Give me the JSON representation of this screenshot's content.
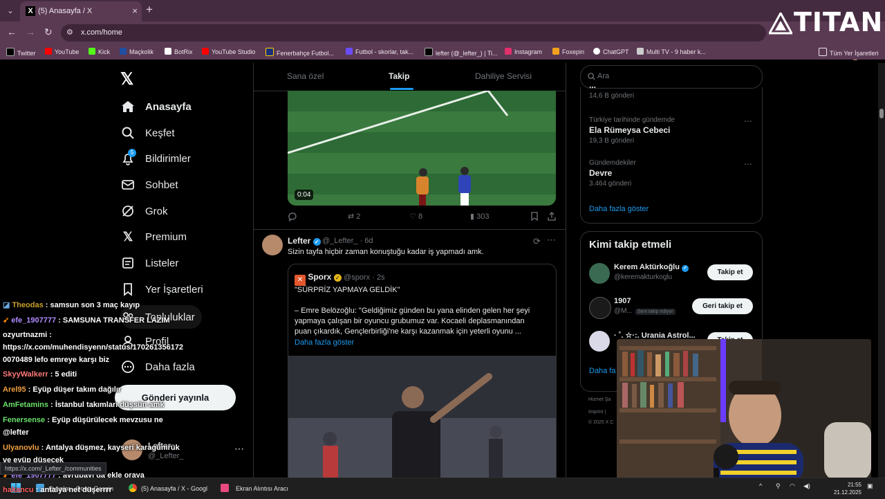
{
  "browser": {
    "tab_title": "(5) Anasayfa / X",
    "tab_close": "×",
    "new_tab": "+",
    "url": "x.com/home",
    "overlay_brand": "TITAN",
    "bookmarks": [
      {
        "label": "Twitter",
        "color": "#000000"
      },
      {
        "label": "YouTube",
        "color": "#ff0000"
      },
      {
        "label": "Kick",
        "color": "#53fc18"
      },
      {
        "label": "Maçkolik",
        "color": "#1f4ea3"
      },
      {
        "label": "BotRix",
        "color": "#ffffff"
      },
      {
        "label": "YouTube Studio",
        "color": "#ff0000"
      },
      {
        "label": "Fenerbahçe Futbol...",
        "color": "#1b2f7a"
      },
      {
        "label": "Futbol - skorlar, tak...",
        "color": "#6a4cff"
      },
      {
        "label": "lefter (@_lefter_) | Ti...",
        "color": "#000000"
      },
      {
        "label": "Instagram",
        "color": "#e1306c"
      },
      {
        "label": "Foxepin",
        "color": "#f4a21d"
      },
      {
        "label": "ChatGPT",
        "color": "#ffffff"
      },
      {
        "label": "Multi TV - 9 haber k...",
        "color": "#cccccc"
      }
    ],
    "all_bookmarks": "Tüm Yer İşaretleri"
  },
  "sidebar": {
    "items": [
      {
        "label": "Anasayfa",
        "icon": "home-icon"
      },
      {
        "label": "Keşfet",
        "icon": "search-icon"
      },
      {
        "label": "Bildirimler",
        "icon": "bell-icon"
      },
      {
        "label": "Sohbet",
        "icon": "mail-icon"
      },
      {
        "label": "Grok",
        "icon": "grok-icon"
      },
      {
        "label": "Premium",
        "icon": "x-premium-icon"
      },
      {
        "label": "Listeler",
        "icon": "list-icon"
      },
      {
        "label": "Yer İşaretleri",
        "icon": "bookmark-icon"
      },
      {
        "label": "Topluluklar",
        "icon": "communities-icon"
      },
      {
        "label": "Profil",
        "icon": "profile-icon"
      },
      {
        "label": "Daha fazla",
        "icon": "more-icon"
      }
    ],
    "notification_count": "5",
    "post_button": "Gönderi yayınla",
    "account_name": "Lefter",
    "account_handle": "@_Lefter_"
  },
  "feed": {
    "tabs": [
      "Sana özel",
      "Takip",
      "Dahiliye Servisi"
    ],
    "video_time": "0:04",
    "post1_stats": {
      "reposts": "2",
      "likes": "8",
      "views": "303"
    },
    "post2": {
      "name": "Lefter",
      "handle": "@_Lefter_ · 6d",
      "text": "Sizin tayfa hiçbir zaman konuştuğu kadar iş yapmadı amk.",
      "quote": {
        "name": "Sporx",
        "handle": "@sporx · 2s",
        "lines": [
          "\"SÜRPRİZ YAPMAYA GELDİK\"",
          "– Emre Belözoğlu: \"Geldiğimiz günden bu yana elinden gelen her şeyi",
          "yapmaya çalışan bir oyuncu grubumuz var. Kocaeli deplasmanından",
          "puan çıkardık, Gençlerbirliği'ne karşı kazanmak için yeterli oyunu ..."
        ],
        "more": "Daha fazla göster"
      }
    }
  },
  "right": {
    "search_placeholder": "Ara",
    "trends": [
      {
        "category": "",
        "name": "...",
        "count": "14,6 B gönderi"
      },
      {
        "category": "Türkiye tarihinde gündemde",
        "name": "Ela Rümeysa Cebeci",
        "count": "19,3 B gönderi"
      },
      {
        "category": "Gündemdekiler",
        "name": "Devre",
        "count": "3.464 gönderi"
      }
    ],
    "trends_more": "Daha fazla göster",
    "who_title": "Kimi takip etmeli",
    "who": [
      {
        "name": "Kerem Aktürkoğlu",
        "handle": "@keremakturkoglu",
        "button": "Takip et",
        "badge": ""
      },
      {
        "name": "1907",
        "handle": "@M...",
        "button": "Geri takip et",
        "badge": "Seni takip ediyor"
      },
      {
        "name": "· ˚. ☆·:. Urania Astrol...",
        "handle": "",
        "button": "Takip et",
        "badge": ""
      }
    ],
    "who_more": "Daha fa",
    "footer_lines": [
      "Hizmet Şa",
      "Imprint  |",
      "© 2025 X C"
    ]
  },
  "chat": [
    {
      "user": "Theodas",
      "msg": "samsun son 3 maç kayıp",
      "color": "#c9a227"
    },
    {
      "user": "efe_1907777",
      "msg": "SAMSUNA TRANSFER LAZIM",
      "color": "#b18cff"
    },
    {
      "user": "ozyurtnazmi",
      "msg": "",
      "color": "#ffffff"
    },
    {
      "user": "",
      "msg": "https://x.com/muhendisyenn/status/170261356172",
      "color": "#ffffff"
    },
    {
      "user": "",
      "msg": "0070489 lefo emreye karşı biz",
      "color": "#ffffff"
    },
    {
      "user": "SkyyWalkerr",
      "msg": "5 editi",
      "color": "#ff7a7a"
    },
    {
      "user": "Arel95",
      "msg": "Eyüp düşer takım dağılır",
      "color": "#f0a040"
    },
    {
      "user": "AmFetamins",
      "msg": "İstanbul takımları düşsün amk",
      "color": "#6ae06a"
    },
    {
      "user": "Fenersense",
      "msg": "Eyüp düşürülecek mevzusu ne",
      "color": "#6ae06a"
    },
    {
      "user": "",
      "msg": "@lefter",
      "color": "#ffffff"
    },
    {
      "user": "Ulyanovlu",
      "msg": "Antalya düşmez, kayseri karagümrük",
      "color": "#f0a040"
    },
    {
      "user": "",
      "msg": "ve eyüp düşecek",
      "color": "#ffffff"
    },
    {
      "user": "efe_1907777",
      "msg": "avrupayı da ekle oraya",
      "color": "#b18cff"
    },
    {
      "user": "hakancu",
      "msg": "antalya net düşerrrr",
      "color": "#ff5a5a"
    }
  ],
  "status_url": "https://x.com/_Lefter_/communities",
  "taskbar": {
    "items": [
      "Oyunlar - Oowa Gezgin",
      "(5) Anasayfa / X - Googl",
      "Ekran Alıntısı Aracı"
    ],
    "time": "21:55",
    "date": "21.12.2025"
  },
  "colors": {
    "accent": "#1d9bf0",
    "chrome": "#5a3a53",
    "background": "#000000"
  }
}
